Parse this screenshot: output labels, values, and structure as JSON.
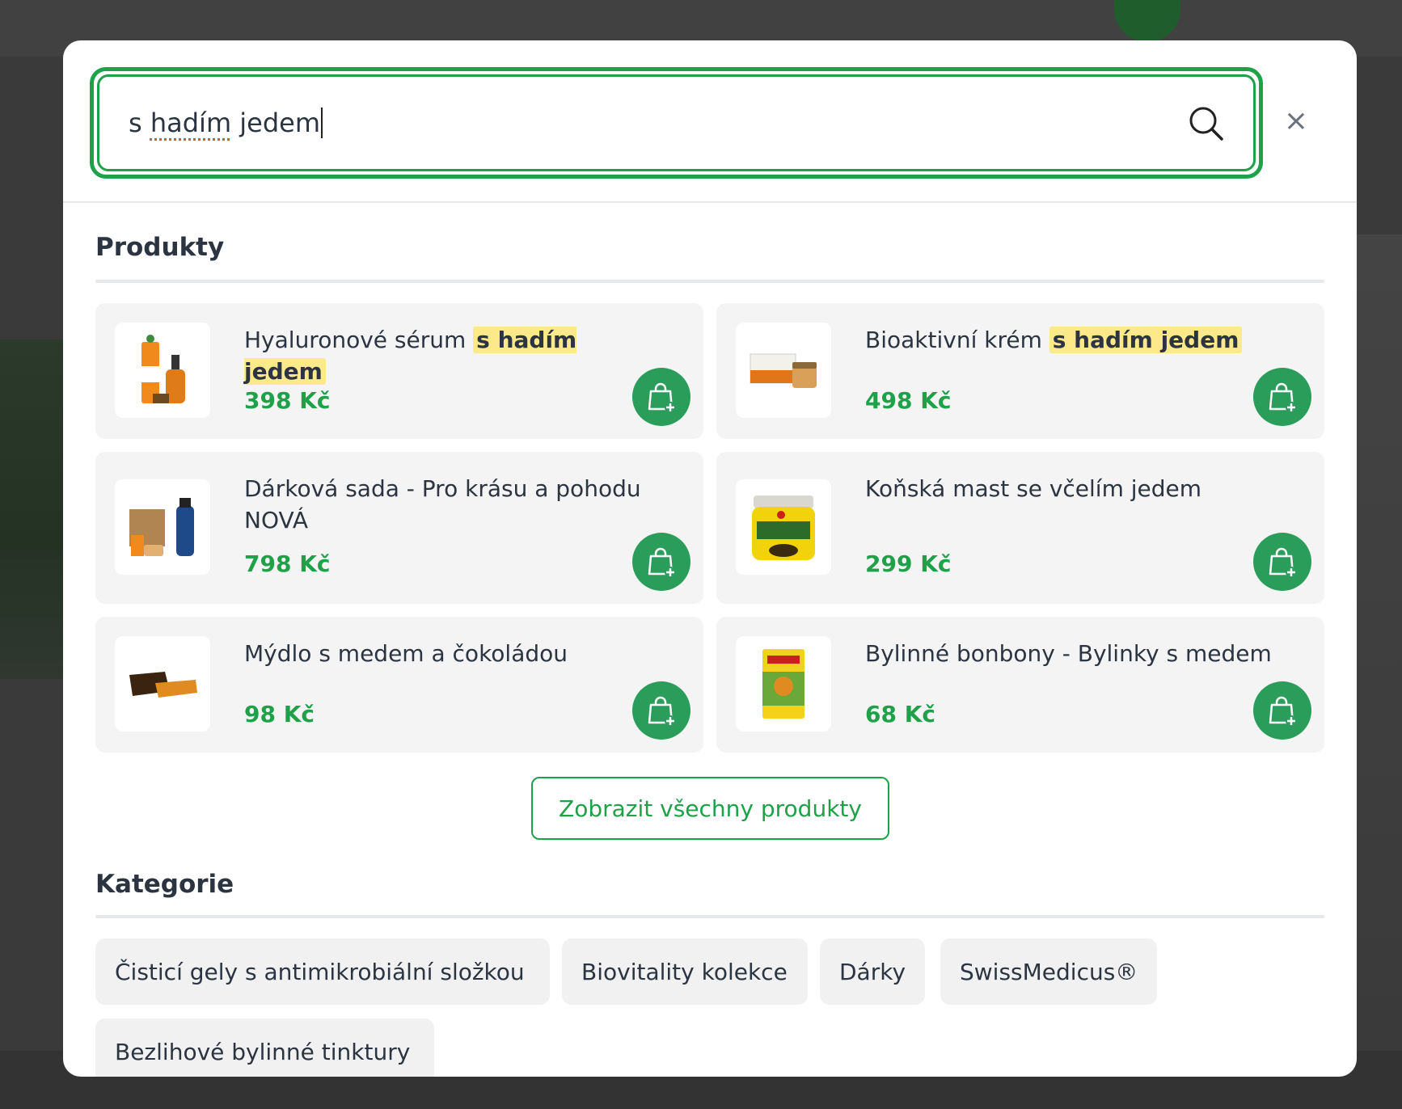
{
  "search": {
    "query_part1": "s ",
    "query_part2": "hadím",
    "query_part3": " jedem"
  },
  "close_label": "×",
  "products": {
    "title": "Produkty",
    "items": [
      {
        "name": "Hyaluronové sérum",
        "highlight": "s hadím jedem",
        "price": "398 Kč"
      },
      {
        "name": "Bioaktivní krém",
        "highlight": "s hadím jedem",
        "price": "498 Kč"
      },
      {
        "name": "Dárková sada - Pro krásu a pohodu NOVÁ",
        "highlight": "",
        "price": "798 Kč"
      },
      {
        "name": "Koňská mast se včelím jedem",
        "highlight": "",
        "price": "299 Kč"
      },
      {
        "name": "Mýdlo s medem a čokoládou",
        "highlight": "",
        "price": "98 Kč"
      },
      {
        "name": "Bylinné bonbony - Bylinky s medem",
        "highlight": "",
        "price": "68 Kč"
      }
    ],
    "show_all": "Zobrazit všechny produkty"
  },
  "categories": {
    "title": "Kategorie",
    "items": [
      "Čisticí gely s antimikrobiální složkou",
      "Biovitality kolekce",
      "Dárky",
      "SwissMedicus®",
      "Bezlihové bylinné tinktury"
    ]
  },
  "colors": {
    "accent": "#1fa14a",
    "cart_button": "#2a9d5a",
    "highlight": "#fbe98a"
  }
}
